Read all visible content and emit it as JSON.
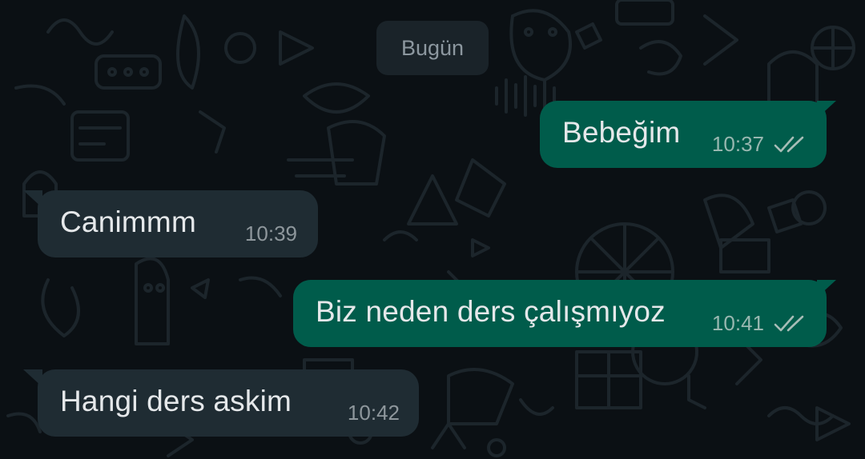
{
  "chat": {
    "date_separator": "Bugün",
    "colors": {
      "background": "#0b1014",
      "outgoing_bubble": "#005c4b",
      "incoming_bubble": "#1f2c33",
      "date_chip": "#1a2329",
      "read_ticks": "#a7bdb7"
    },
    "messages": [
      {
        "direction": "outgoing",
        "text": "Bebeğim",
        "time": "10:37",
        "status_icon": "double-check-icon"
      },
      {
        "direction": "incoming",
        "text": "Canimmm",
        "time": "10:39"
      },
      {
        "direction": "outgoing",
        "text": "Biz neden ders çalışmıyoz",
        "time": "10:41",
        "status_icon": "double-check-icon"
      },
      {
        "direction": "incoming",
        "text": "Hangi ders askim",
        "time": "10:42"
      }
    ]
  }
}
